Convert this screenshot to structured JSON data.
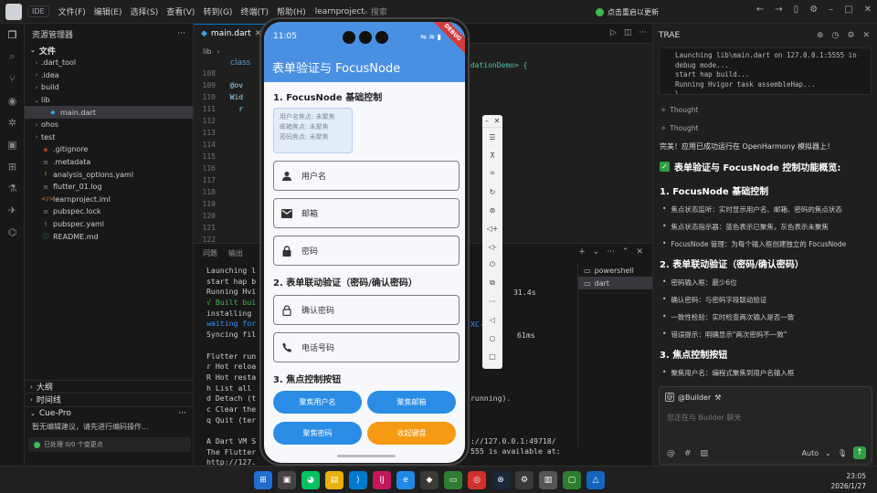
{
  "titlebar": {
    "ide": "IDE",
    "menus": [
      "文件(F)",
      "编辑(E)",
      "选择(S)",
      "查看(V)",
      "转到(G)",
      "终端(T)",
      "帮助(H)"
    ],
    "project": "learnproject",
    "search": "搜索",
    "sync": "点击重启以更新"
  },
  "explorer": {
    "title": "资源管理器",
    "section": "文件",
    "items": [
      {
        "name": ".dart_tool",
        "type": "folder",
        "depth": 1,
        "open": false
      },
      {
        "name": ".idea",
        "type": "folder",
        "depth": 1,
        "open": false
      },
      {
        "name": "build",
        "type": "folder",
        "depth": 1,
        "open": false
      },
      {
        "name": "lib",
        "type": "folder",
        "depth": 1,
        "open": true
      },
      {
        "name": "main.dart",
        "type": "dart",
        "depth": 2,
        "selected": true
      },
      {
        "name": "ohos",
        "type": "folder",
        "depth": 1,
        "open": false
      },
      {
        "name": "test",
        "type": "folder",
        "depth": 1,
        "open": false
      },
      {
        "name": ".gitignore",
        "type": "git",
        "depth": 1
      },
      {
        "name": ".metadata",
        "type": "file",
        "depth": 1
      },
      {
        "name": "analysis_options.yaml",
        "type": "yaml",
        "depth": 1
      },
      {
        "name": "flutter_01.log",
        "type": "file",
        "depth": 1
      },
      {
        "name": "learnproject.iml",
        "type": "xml",
        "depth": 1
      },
      {
        "name": "pubspec.lock",
        "type": "file",
        "depth": 1
      },
      {
        "name": "pubspec.yaml",
        "type": "yaml",
        "depth": 1
      },
      {
        "name": "README.md",
        "type": "info",
        "depth": 1
      }
    ],
    "outline": "大纲",
    "timeline": "时间线",
    "cue_title": "Cue-Pro",
    "cue_text": "暂无编辑建议，请先进行编码操作...",
    "cue_status": "已处理 0/0 个变更点"
  },
  "editor": {
    "tab": "main.dart",
    "breadcrumb": "lib",
    "lines": [
      {
        "n": "108",
        "t": ""
      },
      {
        "n": "109",
        "t": "  @ov"
      },
      {
        "n": "110",
        "t": "  Wid"
      },
      {
        "n": "111",
        "t": "    r"
      },
      {
        "n": "112",
        "t": ""
      },
      {
        "n": "113",
        "t": ""
      },
      {
        "n": "114",
        "t": ""
      },
      {
        "n": "115",
        "t": ""
      },
      {
        "n": "116",
        "t": ""
      },
      {
        "n": "117",
        "t": ""
      },
      {
        "n": "118",
        "t": ""
      },
      {
        "n": "119",
        "t": ""
      },
      {
        "n": "120",
        "t": ""
      },
      {
        "n": "121",
        "t": ""
      },
      {
        "n": "122",
        "t": ""
      }
    ],
    "line_class": "class",
    "line_frag": "idationDemo> {"
  },
  "panel": {
    "tabs": [
      "问题",
      "输出"
    ],
    "terminal_lines": [
      "Launching l",
      "start hap b",
      "Running Hvi",
      "√ Built bui",
      "installing",
      "waiting for",
      "Syncing fil",
      "",
      "Flutter run",
      "r Hot reloa",
      "R Hot resta",
      "h List all",
      "d Detach (t",
      "c Clear the",
      "q Quit (ter",
      "",
      "A Dart VM S",
      "The Flutter",
      "http://127."
    ],
    "term_frags": {
      "t1": "31.4s",
      "t2": "61ms",
      "t3": "XC-k5=/",
      "t4": "running).",
      "t5": "://127.0.0.1:49718/",
      "t6": "555 is available at:"
    },
    "terminals": [
      "powershell",
      "dart"
    ]
  },
  "ai": {
    "title": "TRAE",
    "log": "  Launching lib\\main.dart on 127.0.0.1:5555 in\n  debug mode...\n  start hap build...\n  Running Hvigor task assembleHap...\n  \\",
    "thought": "Thought",
    "done": "完美！应用已成功运行在 OpenHarmony 模拟器上！",
    "overview": "表单验证与 FocusNode 控制功能概览:",
    "s1": "1. FocusNode 基础控制",
    "s1_items": [
      "焦点状态监听：实时显示用户名、邮箱、密码的焦点状态",
      "焦点状态指示器：蓝色表示已聚焦，灰色表示未聚焦",
      "FocusNode 管理：为每个输入框创建独立的 FocusNode"
    ],
    "s2": "2. 表单联动验证（密码/确认密码）",
    "s2_items": [
      "密码输入框：最少6位",
      "确认密码：与密码字段联动验证",
      "一致性检验：实时检查两次输入是否一致",
      "错误提示：明确显示\"两次密码不一致\""
    ],
    "s3": "3. 焦点控制按钮",
    "s3_items": [
      "聚焦用户名：编程式聚焦到用户名输入框"
    ],
    "chip": "@Builder",
    "placeholder": "您正在与 Builder 聊天",
    "mode": "Auto"
  },
  "phone": {
    "time": "11:05",
    "debug": "DEBUG",
    "title": "表单验证与 FocusNode",
    "sec1": "1. FocusNode 基础控制",
    "focus_status": [
      "用户名焦点: 未聚焦",
      "邮箱焦点: 未聚焦",
      "密码焦点: 未聚焦"
    ],
    "fields1": [
      {
        "label": "用户名",
        "icon": "person-icon"
      },
      {
        "label": "邮箱",
        "icon": "email-icon"
      },
      {
        "label": "密码",
        "icon": "lock-icon"
      }
    ],
    "sec2": "2. 表单联动验证（密码/确认密码）",
    "fields2": [
      {
        "label": "确认密码",
        "icon": "lock-outline-icon"
      },
      {
        "label": "电话号码",
        "icon": "phone-icon"
      }
    ],
    "sec3": "3. 焦点控制按钮",
    "buttons": [
      "聚焦用户名",
      "聚焦邮箱",
      "聚焦密码",
      "收起键盘"
    ]
  },
  "taskbar": {
    "time": "23:05",
    "date": "2026/1/27"
  }
}
